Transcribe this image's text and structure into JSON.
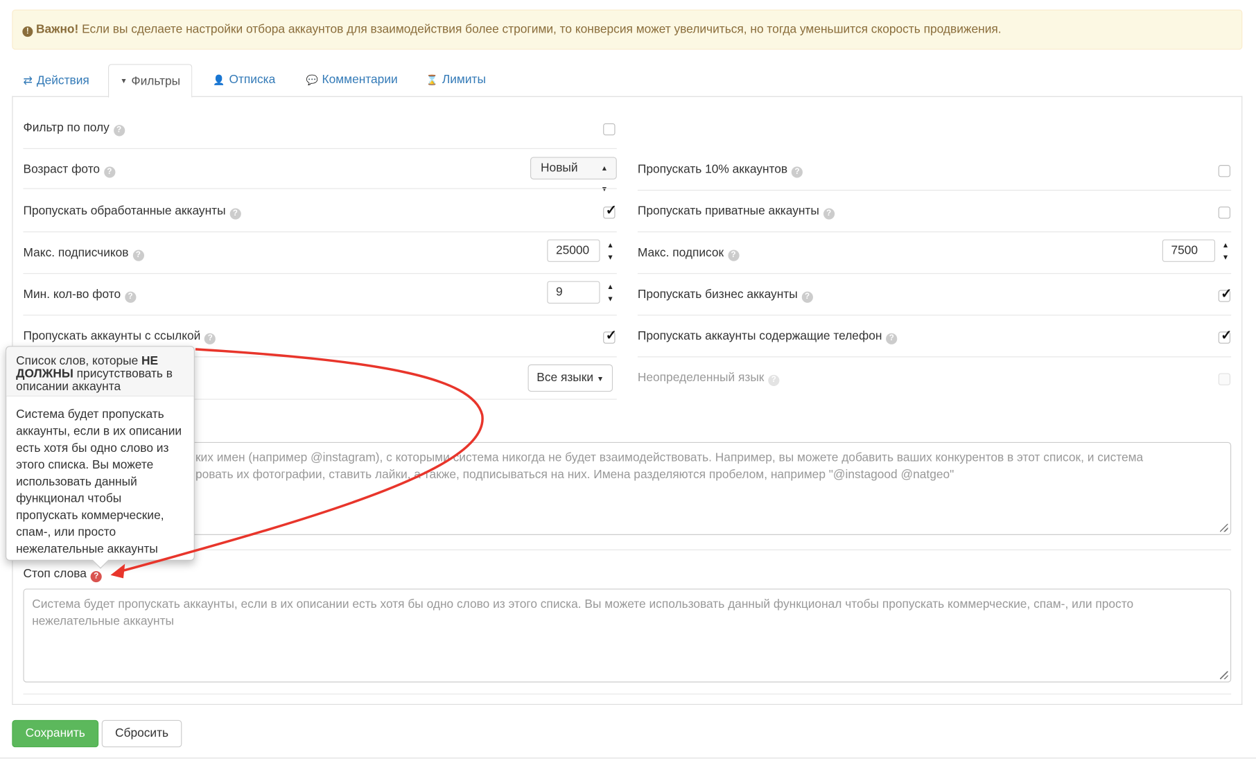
{
  "alert": {
    "icon": "exclamation-circle-icon",
    "strong": "Важно!",
    "text": "Если вы сделаете настройки отбора аккаунтов для взаимодействия более строгими, то конверсия может увеличиться, но тогда уменьшится скорость продвижения."
  },
  "tabs": [
    {
      "label": "Действия",
      "icon": "exchange-icon",
      "glyph": "⇄"
    },
    {
      "label": "Фильтры",
      "icon": "filter-icon",
      "glyph": "▼"
    },
    {
      "label": "Отписка",
      "icon": "user-remove-icon",
      "glyph": "👤"
    },
    {
      "label": "Комментарии",
      "icon": "comment-icon",
      "glyph": "💬"
    },
    {
      "label": "Лимиты",
      "icon": "hourglass-icon",
      "glyph": "⌛"
    }
  ],
  "filters": {
    "gender": {
      "label": "Фильтр по полу",
      "checked": false
    },
    "photo_age": {
      "label": "Возраст фото",
      "value": "Новый"
    },
    "skip_processed": {
      "label": "Пропускать обработанные аккаунты",
      "checked": true
    },
    "max_followers": {
      "label": "Макс. подписчиков",
      "value": "25000"
    },
    "min_photos": {
      "label": "Мин. кол-во фото",
      "value": "9"
    },
    "skip_with_link": {
      "label": "Пропускать аккаунты с ссылкой",
      "checked": true
    },
    "language": {
      "value": "Все языки"
    },
    "skip_10pct": {
      "label": "Пропускать 10% аккаунтов",
      "checked": false
    },
    "skip_private": {
      "label": "Пропускать приватные аккаунты",
      "checked": false
    },
    "max_following": {
      "label": "Макс. подписок",
      "value": "7500"
    },
    "skip_business": {
      "label": "Пропускать бизнес аккаунты",
      "checked": true
    },
    "skip_phone": {
      "label": "Пропускать аккаунты содержащие телефон",
      "checked": true
    },
    "undefined_lang": {
      "label": "Неопределенный язык",
      "checked": false
    }
  },
  "blacklist": {
    "placeholder_line1": "ких имен (например @instagram), с которыми система никогда не будет взаимодействовать. Например, вы можете добавить ваших конкурентов в этот список, и система",
    "placeholder_line2": "ровать их фотографии, ставить лайки, а также, подписываться на них. Имена разделяются пробелом, например \"@instagood @natgeo\""
  },
  "stopwords": {
    "label": "Стоп слова",
    "placeholder": "Система будет пропускать аккаунты, если в их описании есть хотя бы одно слово из этого списка. Вы можете использовать данный функционал чтобы пропускать коммерческие, спам-, или просто нежелательные аккаунты"
  },
  "tooltip": {
    "title_part1": "Список слов, которые ",
    "title_strong": "НЕ ДОЛЖНЫ",
    "title_part2": " присутствовать в описании аккаунта",
    "body": "Система будет пропускать аккаунты, если в их описании есть хотя бы одно слово из этого списка. Вы можете использовать данный функционал чтобы пропускать коммерческие, спам-, или просто нежелательные аккаунты"
  },
  "actions": {
    "save": "Сохранить",
    "reset": "Сбросить"
  },
  "colors": {
    "primary": "#337ab7",
    "success": "#5cb85c",
    "warning_bg": "#fcf8e3",
    "warning_text": "#8a6d3b",
    "annotation_arrow": "#e8352b",
    "help_red": "#d9534f"
  }
}
